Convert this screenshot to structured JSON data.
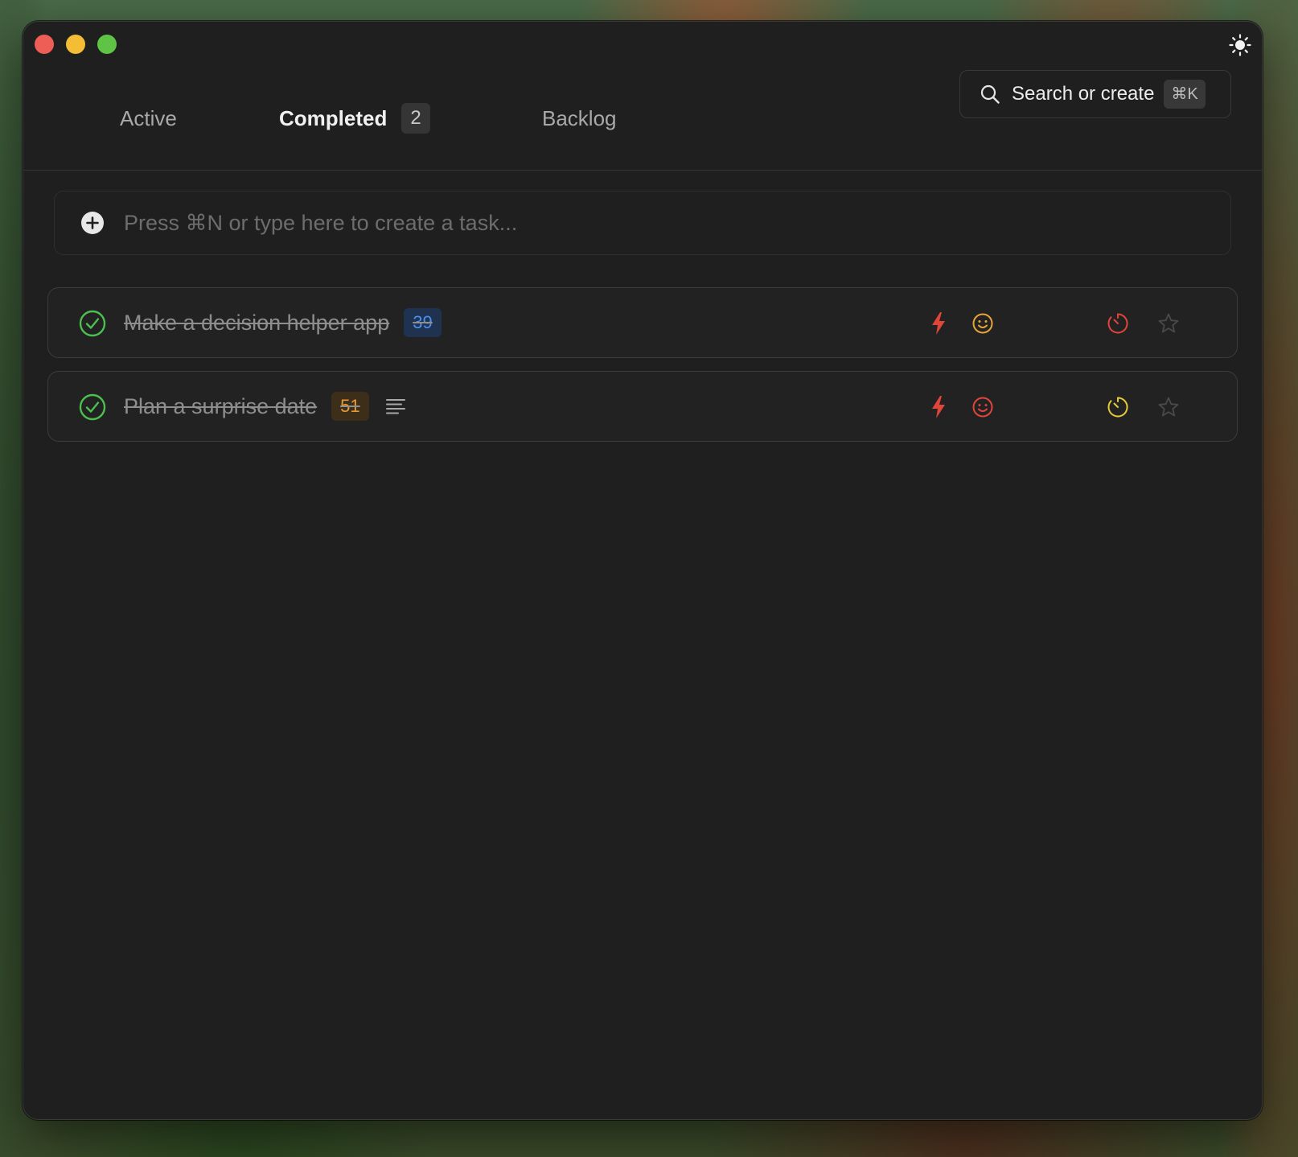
{
  "window": {
    "traffic_lights": [
      "close",
      "minimize",
      "maximize"
    ],
    "theme_toggle_icon": "sun-icon"
  },
  "tabs": [
    {
      "label": "Active",
      "selected": false
    },
    {
      "label": "Completed",
      "selected": true,
      "badge": "2"
    },
    {
      "label": "Backlog",
      "selected": false
    }
  ],
  "search": {
    "label": "Search or create",
    "shortcut": "⌘K",
    "icon": "search-icon"
  },
  "composer": {
    "placeholder": "Press ⌘N or type here to create a task...",
    "icon": "plus-circle-icon"
  },
  "tasks": [
    {
      "title": "Make a decision helper app",
      "badge": "39",
      "badge_color": "#4d8ff0",
      "completed": true,
      "has_notes": false,
      "energy_color": "#e0453a",
      "mood_color": "#e8a33a",
      "timer_color": "#e0453a",
      "starred": false
    },
    {
      "title": "Plan a surprise date",
      "badge": "51",
      "badge_color": "#e59a3a",
      "completed": true,
      "has_notes": true,
      "energy_color": "#e0453a",
      "mood_color": "#e0453a",
      "timer_color": "#e6c93a",
      "starred": false
    }
  ],
  "colors": {
    "check_green": "#4cbf4f",
    "window_bg": "#1f1f1f"
  }
}
